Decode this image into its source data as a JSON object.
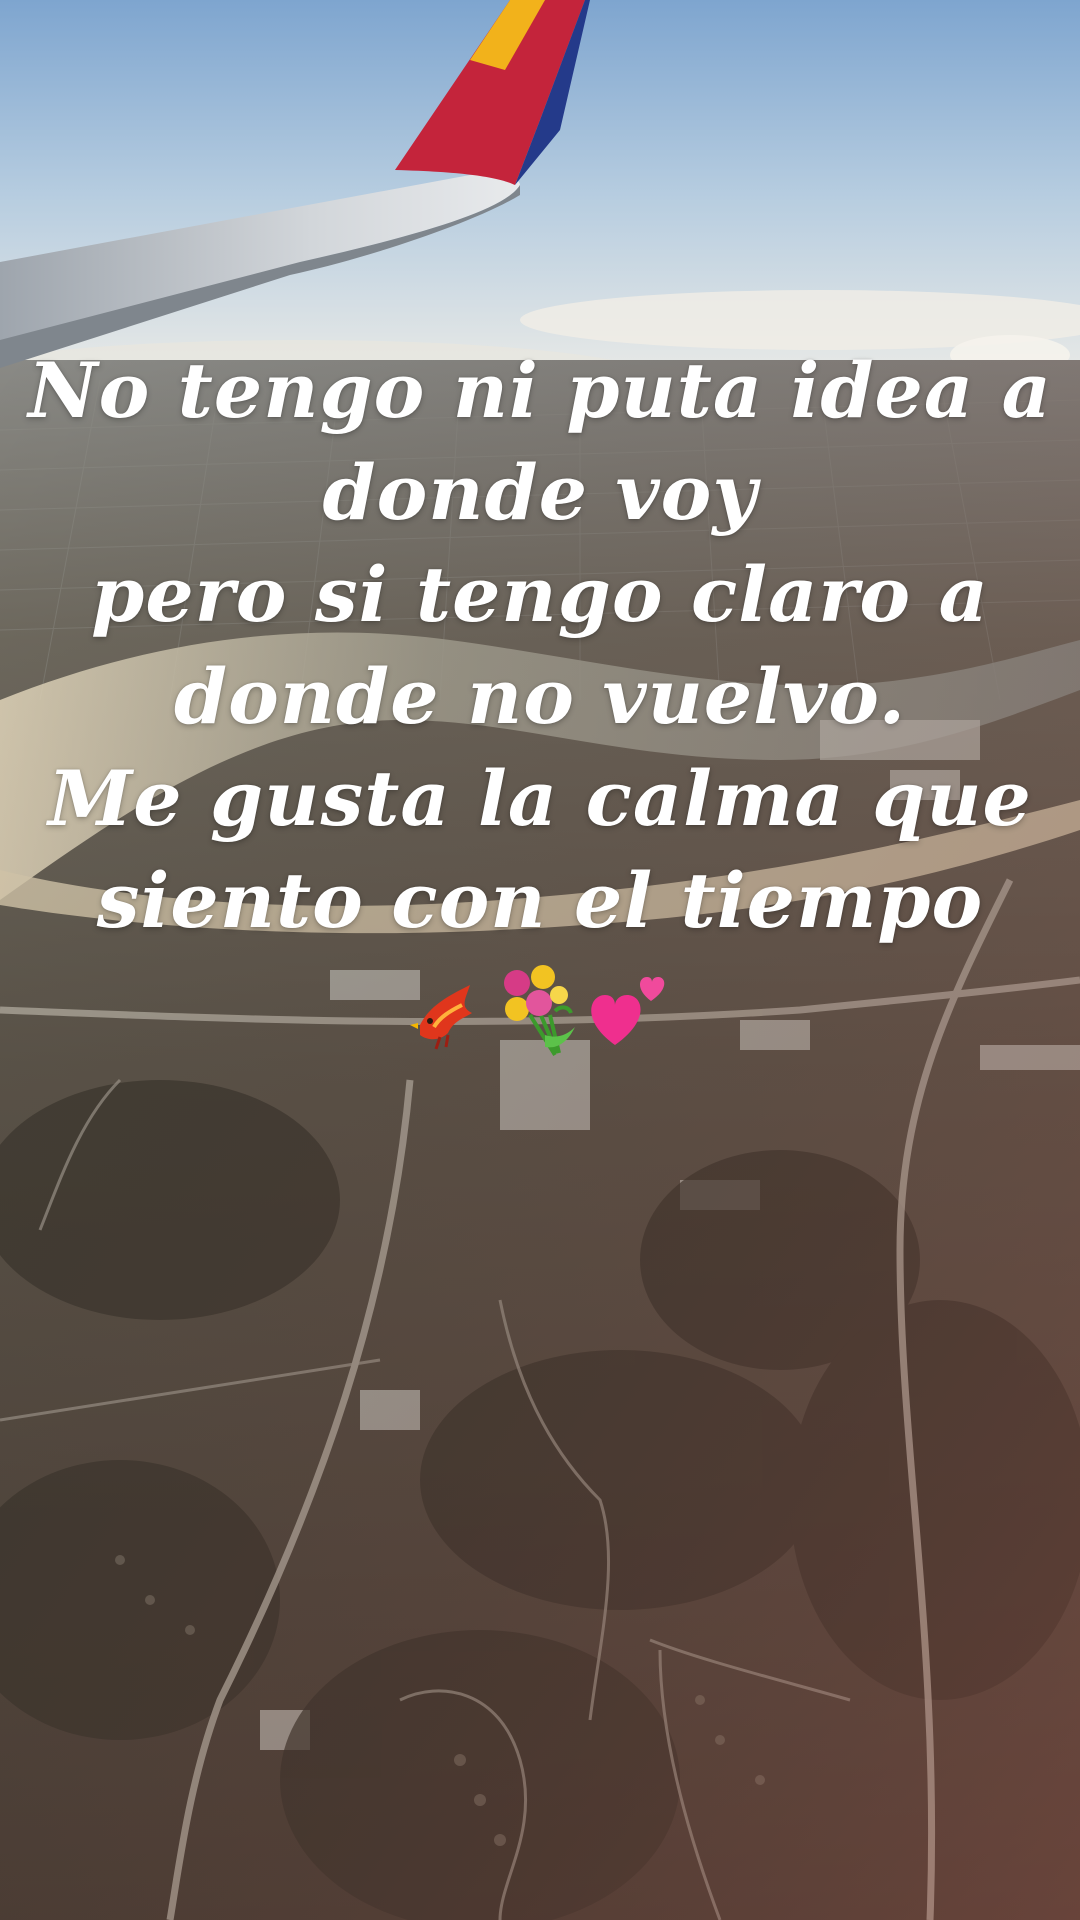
{
  "caption": {
    "lines": [
      "No tengo ni puta idea a",
      "donde voy",
      "pero si tengo claro a",
      "donde no vuelvo.",
      "Me gusta la calma que",
      "siento con el tiempo"
    ]
  },
  "stickers": [
    "bird-sticker",
    "flower-bouquet-sticker",
    "two-hearts-sticker"
  ],
  "colors": {
    "sky_top": "#7fa6cf",
    "sky_horizon": "#e6ebef",
    "ground_dark": "#4a463d",
    "river": "#b8b4a3",
    "wing_tip_red": "#c4243b",
    "wing_tip_yellow": "#f2b21b",
    "wing_tip_blue": "#243a8a"
  }
}
